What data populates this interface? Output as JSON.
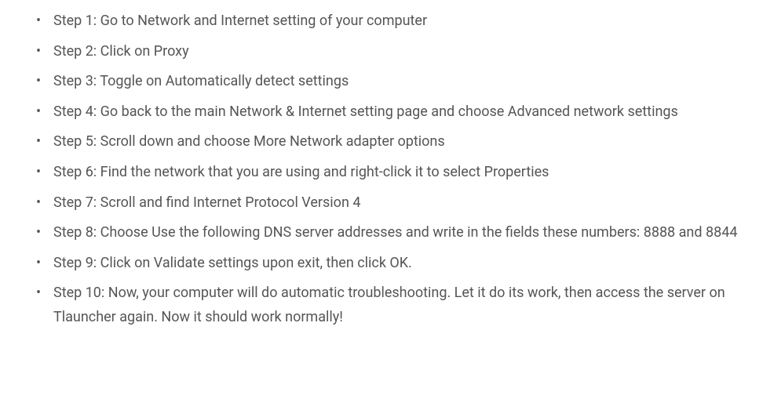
{
  "steps": [
    "Step 1: Go to Network and Internet setting of your computer",
    "Step 2: Click on Proxy",
    "Step 3: Toggle on Automatically detect settings",
    "Step 4: Go back to the main Network & Internet setting page and choose Advanced network settings",
    "Step 5: Scroll down and choose More Network adapter options",
    "Step 6: Find the network that you are using and right-click it to select Properties",
    "Step 7: Scroll and find Internet Protocol Version 4",
    "Step 8: Choose Use the following DNS server addresses and write in the fields these numbers: 8888 and 8844",
    "Step 9: Click on Validate settings upon exit, then click OK.",
    "Step 10: Now, your computer will do automatic troubleshooting. Let it do its work, then access the server on Tlauncher again. Now it should work normally!"
  ]
}
